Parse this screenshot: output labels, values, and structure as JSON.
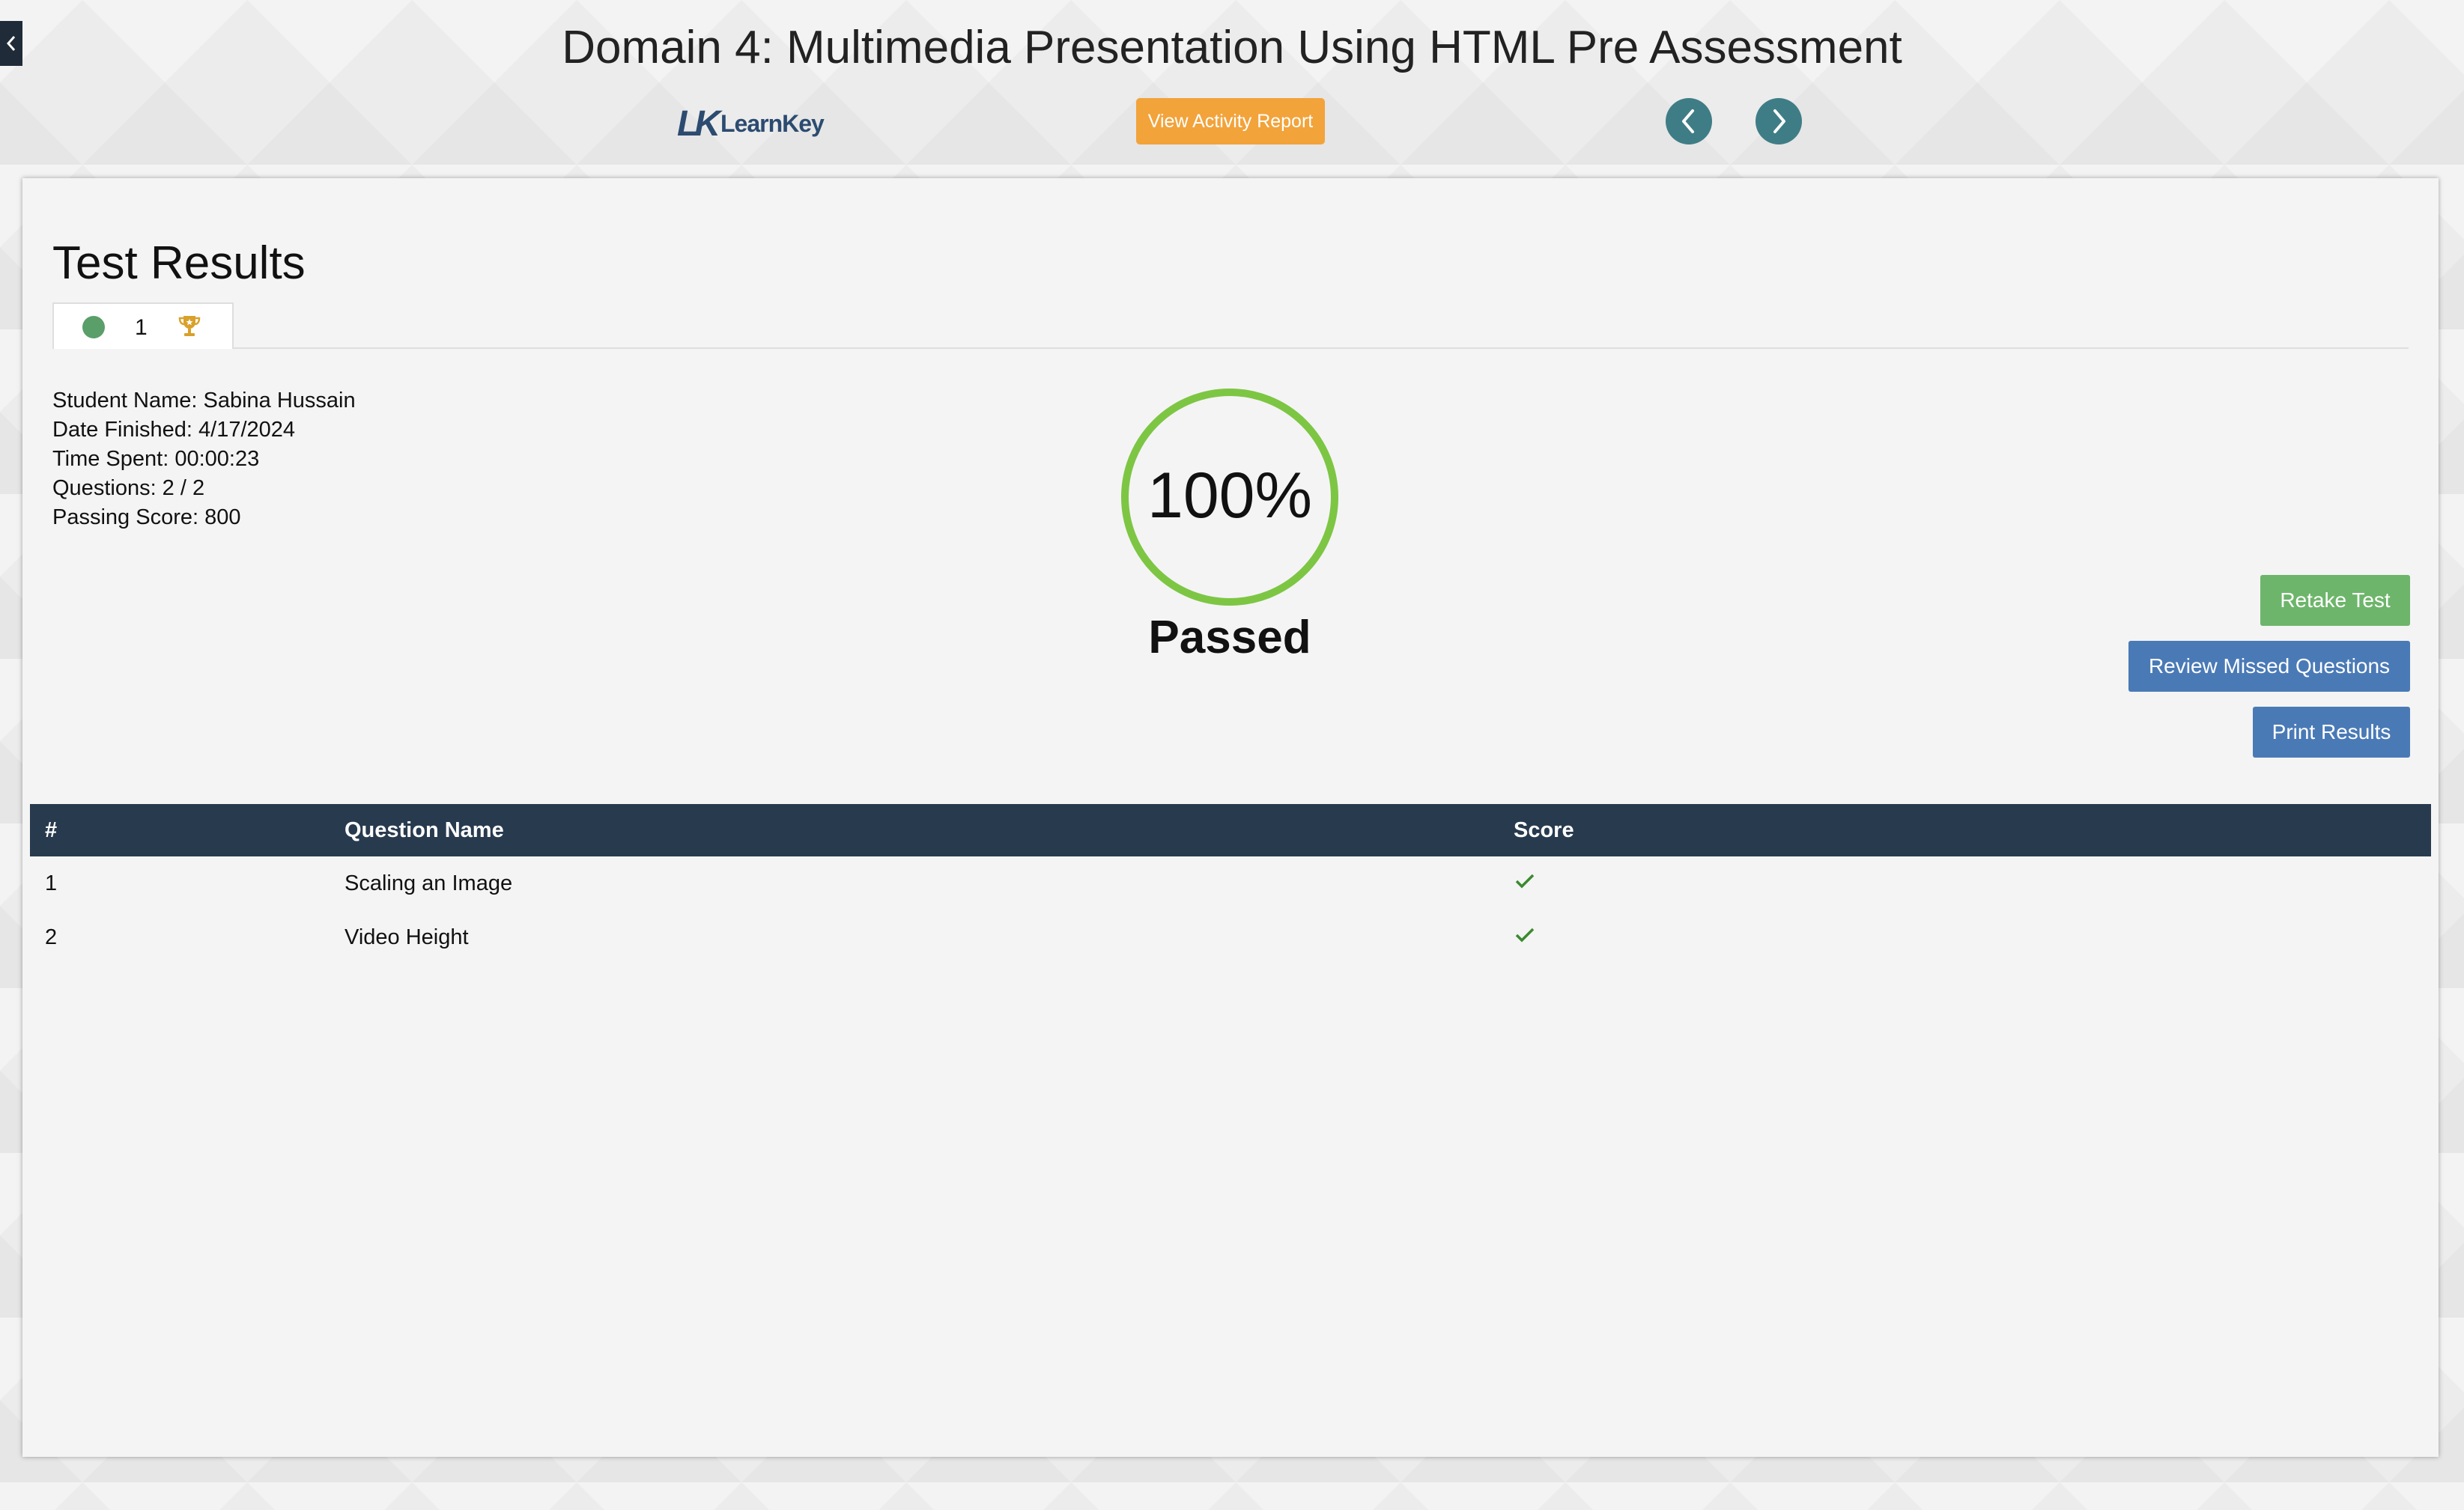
{
  "header": {
    "title": "Domain 4: Multimedia Presentation Using HTML Pre Assessment",
    "logo_mark": "LK",
    "logo_text": "LearnKey",
    "activity_report_label": "View Activity Report"
  },
  "results": {
    "title": "Test Results",
    "attempt_tab": {
      "number": "1",
      "status_color": "#5a9e6a",
      "trophy_color": "#d9a12b"
    },
    "info": {
      "student_name": "Student Name: Sabina Hussain",
      "date_finished": "Date Finished: 4/17/2024",
      "time_spent": "Time Spent: 00:00:23",
      "questions": "Questions: 2 / 2",
      "passing_score": "Passing Score: 800"
    },
    "score_percent": "100%",
    "score_fraction": 1.0,
    "status": "Passed",
    "ring_color": "#7dc643",
    "buttons": {
      "retake": "Retake Test",
      "review_missed": "Review Missed Questions",
      "print": "Print Results"
    }
  },
  "table": {
    "headers": {
      "num": "#",
      "name": "Question Name",
      "score": "Score"
    },
    "rows": [
      {
        "num": "1",
        "name": "Scaling an Image",
        "correct": true
      },
      {
        "num": "2",
        "name": "Video Height",
        "correct": true
      }
    ]
  },
  "colors": {
    "accent_orange": "#f2a33a",
    "nav_teal": "#3f7d86",
    "table_header": "#283a4e",
    "button_blue": "#4a7ab6",
    "button_green": "#6db56a",
    "check_green": "#3a8a2e"
  }
}
